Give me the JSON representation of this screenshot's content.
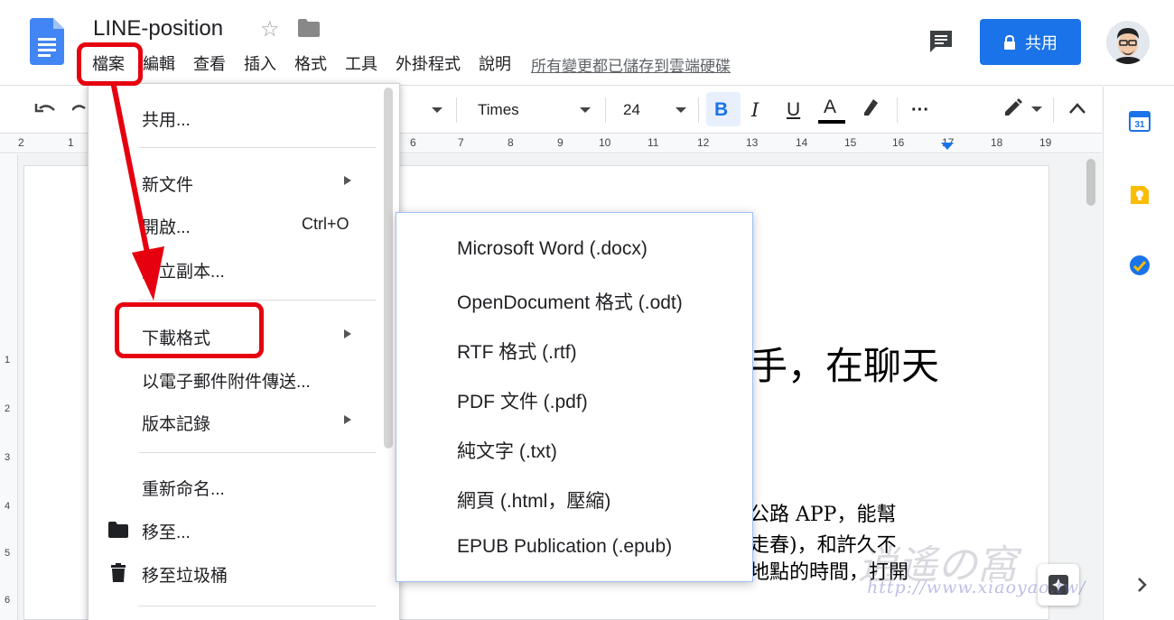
{
  "document": {
    "title": "LINE-position",
    "saved_status": "所有變更都已儲存到雲端硬碟"
  },
  "menubar": [
    "檔案",
    "編輯",
    "查看",
    "插入",
    "格式",
    "工具",
    "外掛程式",
    "說明"
  ],
  "header": {
    "share_label": "共用"
  },
  "toolbar": {
    "font": "Times",
    "font_size": "24",
    "bold": "B",
    "italic": "I",
    "underline": "U",
    "text_color": "A",
    "more": "···"
  },
  "ruler": {
    "labels": [
      "2",
      "1",
      "6",
      "7",
      "8",
      "9",
      "10",
      "11",
      "12",
      "13",
      "14",
      "15",
      "16",
      "17",
      "18",
      "19"
    ]
  },
  "vruler": {
    "labels": [
      "1",
      "2",
      "3",
      "4",
      "5",
      "6"
    ]
  },
  "file_menu": {
    "share": "共用...",
    "new_doc": "新文件",
    "open": "開啟...",
    "open_shortcut": "Ctrl+O",
    "make_copy": "建立副本...",
    "download": "下載格式",
    "email_attachment": "以電子郵件附件傳送...",
    "version_history": "版本記錄",
    "rename": "重新命名...",
    "move_to": "移至...",
    "move_to_trash": "移至垃圾桶"
  },
  "download_submenu": [
    "Microsoft Word (.docx)",
    "OpenDocument 格式 (.odt)",
    "RTF 格式 (.rtf)",
    "PDF 文件 (.pdf)",
    "純文字 (.txt)",
    "網頁 (.html，壓縮)",
    "EPUB Publication (.epub)"
  ],
  "document_content": {
    "heading_fragment": "手，在聊天",
    "body_lines": [
      "公路 APP，能幫",
      "走春)，和許久不",
      "地點的時間，打開"
    ]
  },
  "watermark": {
    "text": "逍遙の窩",
    "url": "http://www.xiaoyao.tw/"
  },
  "colors": {
    "accent": "#1a73e8",
    "highlight": "#e6000f"
  }
}
